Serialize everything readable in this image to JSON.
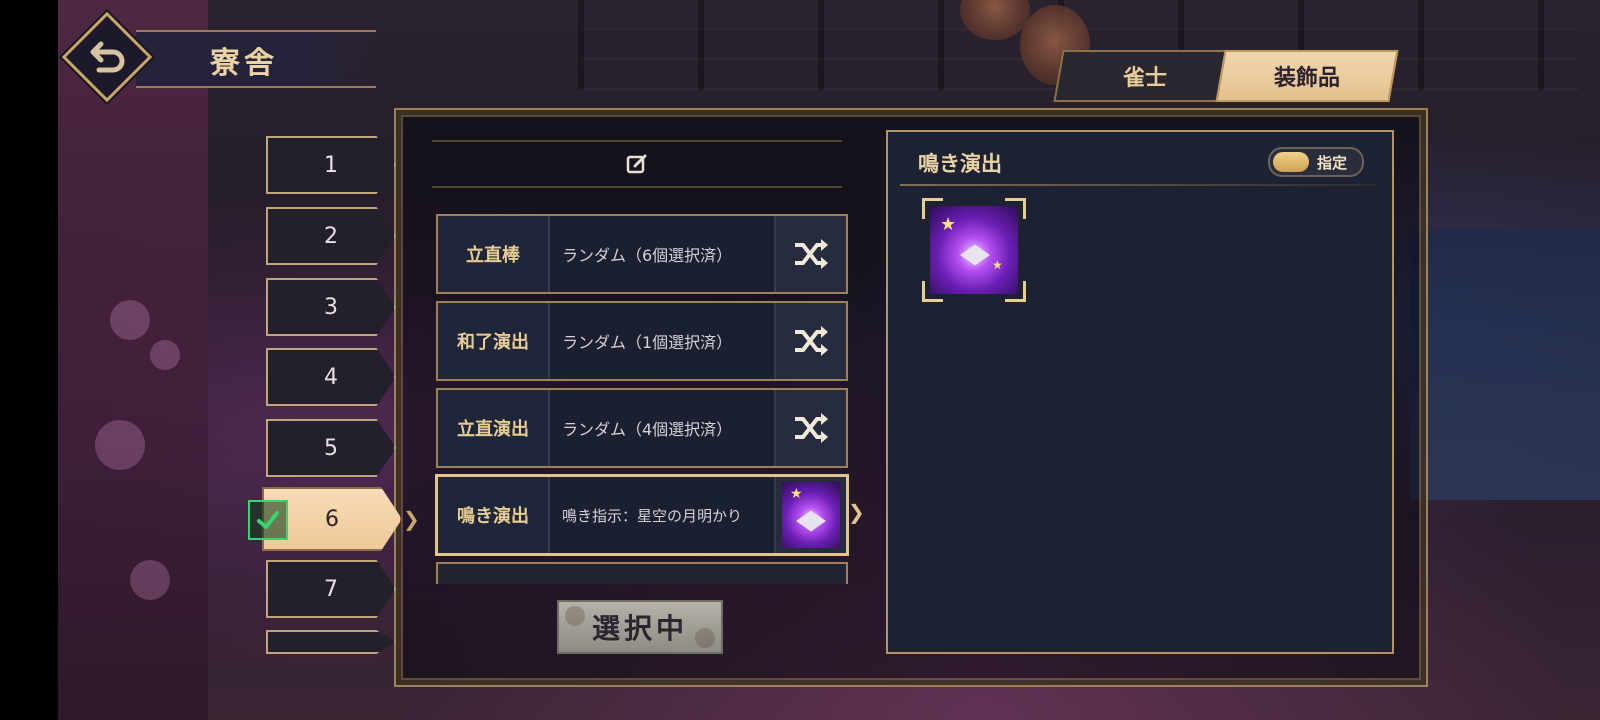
{
  "header": {
    "title": "寮舎"
  },
  "tabs": [
    {
      "label": "雀士",
      "active": false
    },
    {
      "label": "装飾品",
      "active": true
    }
  ],
  "numbers": [
    "1",
    "2",
    "3",
    "4",
    "5",
    "6",
    "7"
  ],
  "numbers_active": "6",
  "setting_rows": [
    {
      "label": "立直棒",
      "value": "ランダム（6個選択済）"
    },
    {
      "label": "和了演出",
      "value": "ランダム（1個選択済）"
    },
    {
      "label": "立直演出",
      "value": "ランダム（4個選択済）"
    },
    {
      "label": "鳴き演出",
      "value": "鳴き指示：星空の月明かり"
    }
  ],
  "select_button": "選択中",
  "panel": {
    "title": "鳴き演出",
    "toggle_label": "指定"
  },
  "colors": {
    "accent_gold": "#c9a66b",
    "active_peach": "#efc996",
    "check_green": "#35d66b",
    "item_purple": "#b44ff0"
  },
  "icons": [
    "back-arrow-icon",
    "edit-icon",
    "shuffle-icon",
    "check-icon",
    "cube-icon",
    "star-icon"
  ]
}
